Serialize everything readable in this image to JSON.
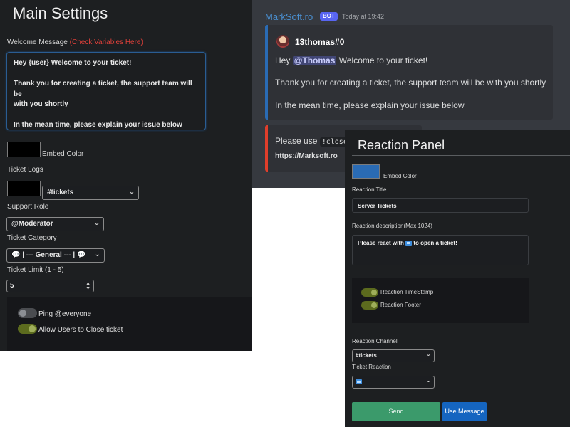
{
  "main_settings": {
    "title": "Main Settings",
    "welcome_label": "Welcome Message",
    "welcome_link": "(Check Variables Here)",
    "welcome_lines": [
      "Hey {user} Welcome to your ticket!",
      "",
      "Thank you for creating a ticket, the support team will be",
      "with you shortly",
      "",
      "In the mean time, please explain your issue below"
    ],
    "embed_color_label": "Embed Color",
    "embed_color": "#000000",
    "ticket_logs_label": "Ticket Logs",
    "ticket_logs_color": "#000000",
    "ticket_logs_channel": "#tickets",
    "support_role_label": "Support Role",
    "support_role_value": "@Moderator",
    "ticket_category_label": "Ticket Category",
    "ticket_category_value": "💬 | --- General --- | 💬",
    "ticket_limit_label": "Ticket Limit (1 - 5)",
    "ticket_limit_value": "5",
    "ping_everyone_label": "Ping @everyone",
    "ping_everyone_enabled": false,
    "allow_close_label": "Allow Users to Close ticket",
    "allow_close_enabled": true
  },
  "discord_preview": {
    "bot_name": "MarkSoft.ro",
    "bot_badge": "BOT",
    "timestamp": "Today at 19:42",
    "author": "13thomas#0",
    "line1_prefix": "Hey",
    "mention": "@Thomas",
    "line1_suffix": "Welcome to your ticket!",
    "line2": "Thank you for creating a ticket, the support team will be with you shortly",
    "line3": "In the mean time, please explain your issue below",
    "embed2_prefix": "Please use",
    "embed2_code": "!close",
    "embed2_link": "https://Marksoft.ro",
    "embed1_color": "#2a6bb4",
    "embed2_color": "#e03e2b"
  },
  "reaction_panel": {
    "title": "Reaction Panel",
    "embed_color_label": "Embed Color",
    "embed_color": "#2a6bb4",
    "reaction_title_label": "Reaction Title",
    "reaction_title_value": "Server Tickets",
    "reaction_desc_label": "Reaction description(Max 1024)",
    "reaction_desc_prefix": "Please react with",
    "reaction_desc_suffix": "to open a ticket!",
    "timestamp_label": "Reaction TimeStamp",
    "timestamp_enabled": true,
    "footer_label": "Reaction Footer",
    "footer_enabled": true,
    "channel_label": "Reaction Channel",
    "channel_value": "#tickets",
    "ticket_reaction_label": "Ticket Reaction",
    "send_label": "Send",
    "use_message_label": "Use Message"
  }
}
